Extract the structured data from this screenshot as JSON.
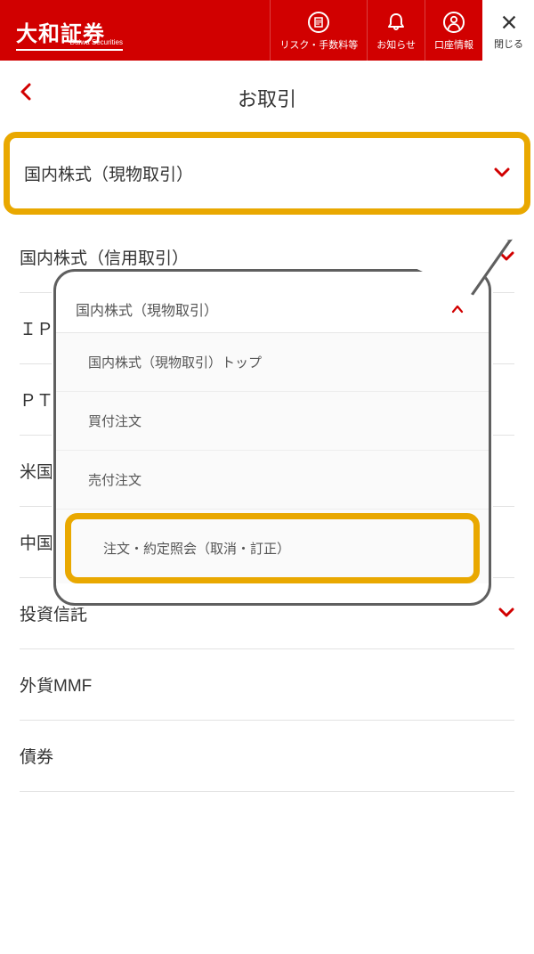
{
  "header": {
    "logo_main": "大和証券",
    "logo_sub": "Daiwa Securities",
    "nav_risk": "リスク・手数料等",
    "nav_notice": "お知らせ",
    "nav_account": "口座情報",
    "nav_close": "閉じる"
  },
  "title_bar": {
    "title": "お取引"
  },
  "list": [
    {
      "label": "国内株式（現物取引）",
      "chev": "down",
      "highlighted": true
    },
    {
      "label": "国内株式（信用取引）",
      "chev": "down"
    },
    {
      "label": "ＩＰＯ・ＰＯ",
      "chev": "none_hidden"
    },
    {
      "label": "ＰＴＳナイトタイム",
      "chev": "none_hidden"
    },
    {
      "label": "米国株",
      "chev": "none_hidden"
    },
    {
      "label": "中国株",
      "chev": "none"
    },
    {
      "label": "投資信託",
      "chev": "down"
    },
    {
      "label": "外貨MMF",
      "chev": "none"
    },
    {
      "label": "債券",
      "chev": "none"
    }
  ],
  "popup": {
    "title": "国内株式（現物取引）",
    "items": [
      "国内株式（現物取引）トップ",
      "買付注文",
      "売付注文",
      "注文・約定照会（取消・訂正）"
    ],
    "highlight_index": 3
  },
  "colors": {
    "brand": "#d10000",
    "highlight": "#e9a800"
  }
}
